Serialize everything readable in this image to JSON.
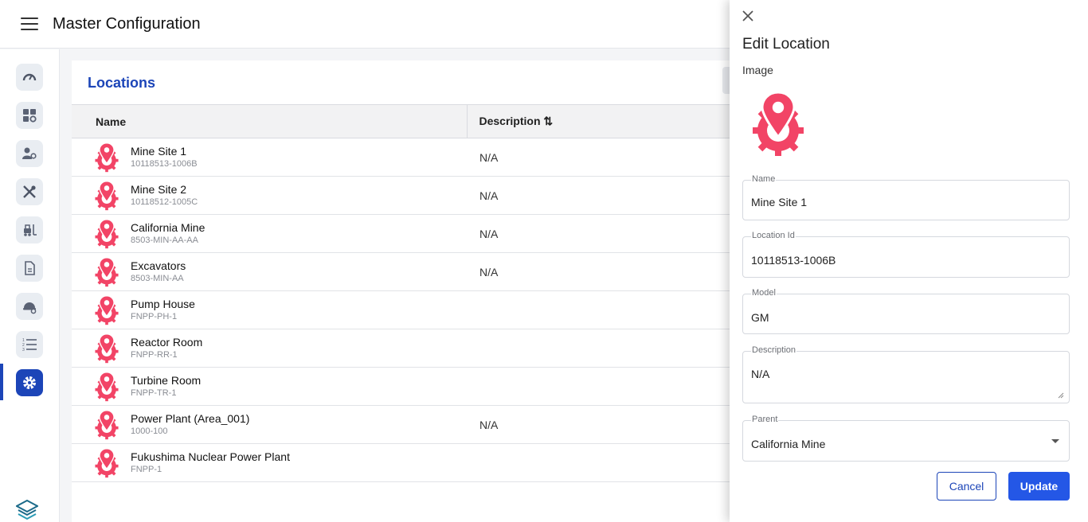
{
  "app": {
    "title": "Master Configuration"
  },
  "sidebar": {
    "items": [
      {
        "icon": "gauge-icon"
      },
      {
        "icon": "dashboard-settings-icon"
      },
      {
        "icon": "user-settings-icon"
      },
      {
        "icon": "tools-icon"
      },
      {
        "icon": "forklift-icon"
      },
      {
        "icon": "document-icon"
      },
      {
        "icon": "hardhat-settings-icon"
      },
      {
        "icon": "numbered-list-icon"
      },
      {
        "icon": "settings-icon",
        "active": true
      }
    ]
  },
  "colors": {
    "accent": "#1c45b8",
    "location_icon": "#f24466",
    "update_button": "#2457e6"
  },
  "locations": {
    "title": "Locations",
    "columns": {
      "name": "Name",
      "description": "Description ⇅"
    },
    "rows": [
      {
        "name": "Mine Site 1",
        "code": "10118513-1006B",
        "description": "N/A"
      },
      {
        "name": "Mine Site 2",
        "code": "10118512-1005C",
        "description": "N/A"
      },
      {
        "name": "California Mine",
        "code": "8503-MIN-AA-AA",
        "description": "N/A"
      },
      {
        "name": "Excavators",
        "code": "8503-MIN-AA",
        "description": "N/A"
      },
      {
        "name": "Pump House",
        "code": "FNPP-PH-1",
        "description": ""
      },
      {
        "name": "Reactor Room",
        "code": "FNPP-RR-1",
        "description": ""
      },
      {
        "name": "Turbine Room",
        "code": "FNPP-TR-1",
        "description": ""
      },
      {
        "name": "Power Plant (Area_001)",
        "code": "1000-100",
        "description": "N/A"
      },
      {
        "name": "Fukushima Nuclear Power Plant",
        "code": "FNPP-1",
        "description": ""
      }
    ]
  },
  "drawer": {
    "title": "Edit Location",
    "image_label": "Image",
    "fields": {
      "name": {
        "label": "Name",
        "value": "Mine Site 1"
      },
      "location_id": {
        "label": "Location Id",
        "value": "10118513-1006B"
      },
      "model": {
        "label": "Model",
        "value": "GM"
      },
      "description": {
        "label": "Description",
        "value": "N/A"
      },
      "parent": {
        "label": "Parent",
        "value": "California Mine"
      }
    },
    "cancel_label": "Cancel",
    "update_label": "Update"
  }
}
